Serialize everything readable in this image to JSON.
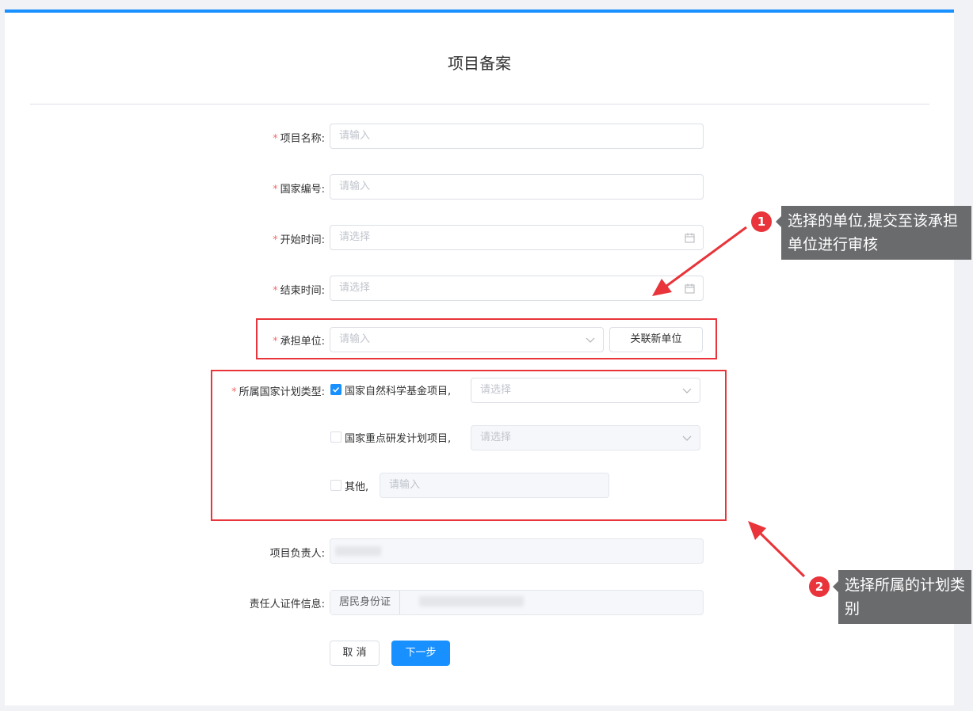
{
  "page": {
    "title": "项目备案"
  },
  "form": {
    "project_name": {
      "label": "项目名称:",
      "placeholder": "请输入"
    },
    "national_no": {
      "label": "国家编号:",
      "placeholder": "请输入"
    },
    "start_time": {
      "label": "开始时间:",
      "placeholder": "请选择"
    },
    "end_time": {
      "label": "结束时间:",
      "placeholder": "请选择"
    },
    "unit": {
      "label": "承担单位:",
      "placeholder": "请输入",
      "link_button": "关联新单位"
    },
    "plan_type": {
      "label": "所属国家计划类型:",
      "options": [
        {
          "label": "国家自然科学基金项目,",
          "checked": true,
          "placeholder": "请选择"
        },
        {
          "label": "国家重点研发计划项目,",
          "checked": false,
          "placeholder": "请选择"
        },
        {
          "label": "其他,",
          "checked": false,
          "placeholder": "请输入"
        }
      ]
    },
    "leader": {
      "label": "项目负责人:"
    },
    "id_info": {
      "label": "责任人证件信息:",
      "prefix": "居民身份证"
    },
    "cancel": "取 消",
    "next": "下一步"
  },
  "annotations": [
    {
      "number": "1",
      "text": "选择的单位,提交至该承担单位进行审核"
    },
    {
      "number": "2",
      "text": "选择所属的计划类别"
    }
  ],
  "colors": {
    "primary": "#1890ff",
    "required": "#f56c6c",
    "annotation_red": "#e8343a",
    "tooltip_bg": "#6a6b6d"
  }
}
